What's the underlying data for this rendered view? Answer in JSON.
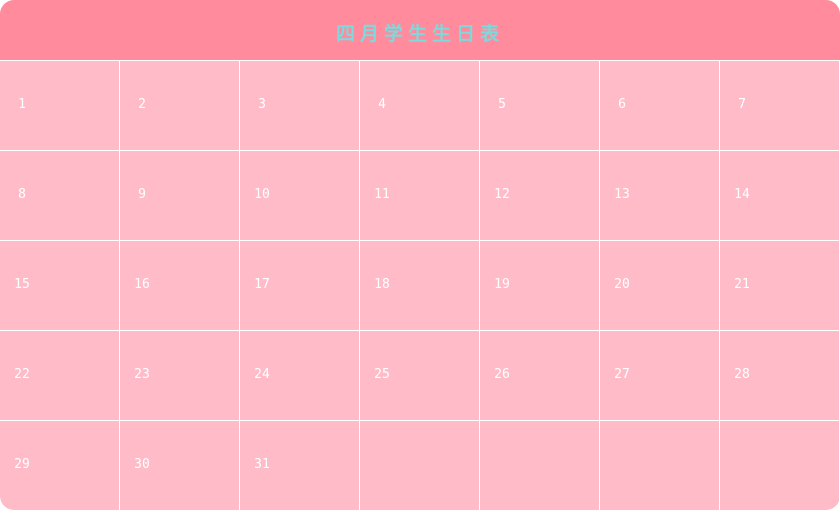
{
  "title": "四月学生生日表",
  "colors": {
    "header": "#ff8b9c",
    "title": "#7fd8dc",
    "cell": "#ffbcc8",
    "grid_line": "#ffffff",
    "day_text": "#ffffff"
  },
  "cells": [
    {
      "day": "1"
    },
    {
      "day": "2"
    },
    {
      "day": "3"
    },
    {
      "day": "4"
    },
    {
      "day": "5"
    },
    {
      "day": "6"
    },
    {
      "day": "7"
    },
    {
      "day": "8"
    },
    {
      "day": "9"
    },
    {
      "day": "10"
    },
    {
      "day": "11"
    },
    {
      "day": "12"
    },
    {
      "day": "13"
    },
    {
      "day": "14"
    },
    {
      "day": "15"
    },
    {
      "day": "16"
    },
    {
      "day": "17"
    },
    {
      "day": "18"
    },
    {
      "day": "19"
    },
    {
      "day": "20"
    },
    {
      "day": "21"
    },
    {
      "day": "22"
    },
    {
      "day": "23"
    },
    {
      "day": "24"
    },
    {
      "day": "25"
    },
    {
      "day": "26"
    },
    {
      "day": "27"
    },
    {
      "day": "28"
    },
    {
      "day": "29"
    },
    {
      "day": "30"
    },
    {
      "day": "31"
    },
    {
      "day": ""
    },
    {
      "day": ""
    },
    {
      "day": ""
    },
    {
      "day": ""
    }
  ]
}
